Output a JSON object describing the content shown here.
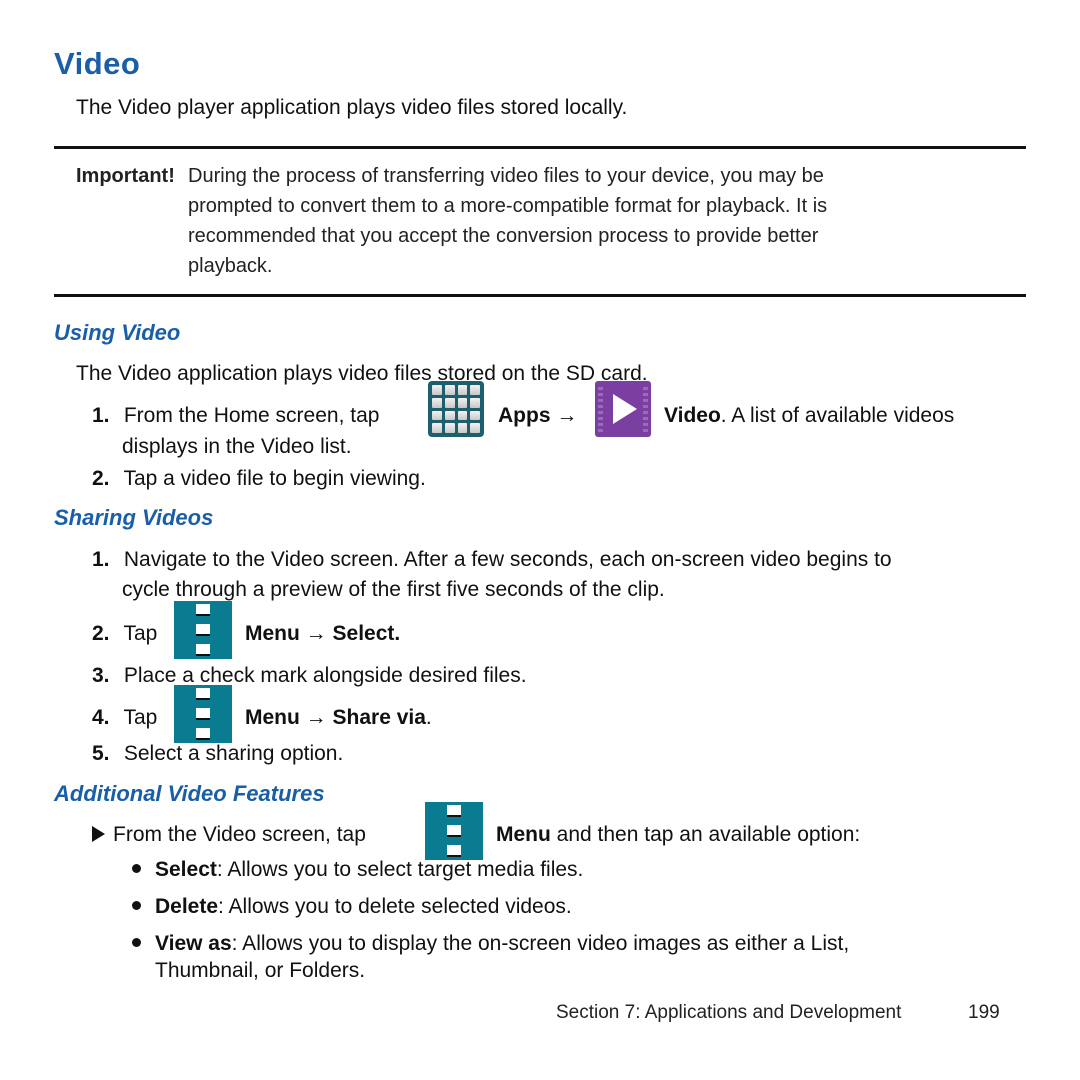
{
  "page": {
    "title": "Video",
    "intro": "The Video player application plays video files stored locally.",
    "important": {
      "label": "Important!",
      "lines": [
        "During the process of transferring video files to your device, you may be",
        "prompted to convert them to a more-compatible format for playback. It is",
        "recommended that you accept the conversion process to provide better",
        "playback."
      ]
    },
    "using_video": {
      "heading": "Using Video",
      "intro": "The Video application plays video files stored on the SD card.",
      "step1": {
        "num": "1.",
        "pre": "From the Home screen, tap",
        "apps": "Apps",
        "arrow": "→",
        "video": "Video",
        "post": ". A list of available videos",
        "cont": "displays in the Video list."
      },
      "step2": {
        "num": "2.",
        "text": "Tap a video file to begin viewing."
      }
    },
    "sharing": {
      "heading": "Sharing Videos",
      "step1": {
        "num": "1.",
        "line1": "Navigate to the Video screen. After a few seconds, each on-screen video begins to",
        "line2": "cycle through a preview of the first five seconds of the clip."
      },
      "step2": {
        "num": "2.",
        "pre": "Tap",
        "menu": "Menu",
        "arrow": "→",
        "action": "Select."
      },
      "step3": {
        "num": "3.",
        "text": "Place a check mark alongside desired files."
      },
      "step4": {
        "num": "4.",
        "pre": "Tap",
        "menu": "Menu",
        "arrow": "→",
        "action": "Share via",
        "post": "."
      },
      "step5": {
        "num": "5.",
        "text": "Select a sharing option."
      }
    },
    "additional": {
      "heading": "Additional Video Features",
      "lead_pre": "From the Video screen, tap",
      "lead_menu": "Menu",
      "lead_post": "and then tap an available option:",
      "bullets": [
        {
          "term": "Select",
          "text": ": Allows you to select target media files."
        },
        {
          "term": "Delete",
          "text": ": Allows you to delete selected videos."
        },
        {
          "term": "View as",
          "text": ": Allows you to display the on-screen video images as either a List,",
          "cont": "Thumbnail, or Folders."
        }
      ]
    },
    "footer": {
      "section": "Section 7:  Applications and Development",
      "page_number": "199"
    },
    "icons": {
      "apps": "apps-grid-icon",
      "video": "video-play-icon",
      "menu": "menu-icon"
    },
    "colors": {
      "heading_blue": "#1a5ea8",
      "menu_teal": "#0a7c92",
      "apps_teal": "#1e5f6e",
      "video_purple": "#7a3fa0"
    }
  }
}
